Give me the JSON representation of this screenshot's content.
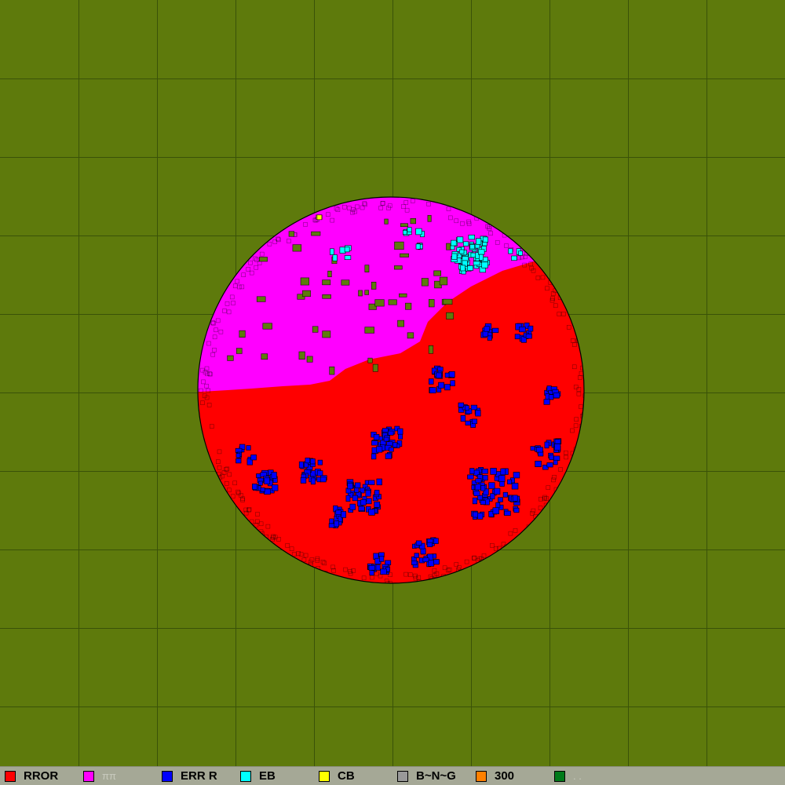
{
  "colors": {
    "background": "#5e7a0c",
    "grid": "#3a5208",
    "legend_bar": "#a5a896"
  },
  "wafer": {
    "outline": "#000000",
    "regions": [
      {
        "name": "magenta-region",
        "color": "#ff00ff"
      },
      {
        "name": "red-region",
        "color": "#ff0000"
      }
    ],
    "defect_clusters": [
      {
        "color": "#0000ff"
      },
      {
        "color": "#00ffff"
      },
      {
        "color": "#ffff00"
      }
    ]
  },
  "legend": {
    "items": [
      {
        "label": "RROR",
        "color": "#ff0000",
        "dim": false
      },
      {
        "label": "ππ",
        "color": "#ff00ff",
        "dim": true
      },
      {
        "label": "ERR R",
        "color": "#0000ff",
        "dim": false
      },
      {
        "label": "EB",
        "color": "#00ffff",
        "dim": false
      },
      {
        "label": "CB",
        "color": "#ffff00",
        "dim": false
      },
      {
        "label": "B~N~G",
        "color": "#999999",
        "dim": false
      },
      {
        "label": "300",
        "color": "#ff8000",
        "dim": false
      },
      {
        "label": ". .",
        "color": "#007a1a",
        "dim": true
      }
    ]
  }
}
